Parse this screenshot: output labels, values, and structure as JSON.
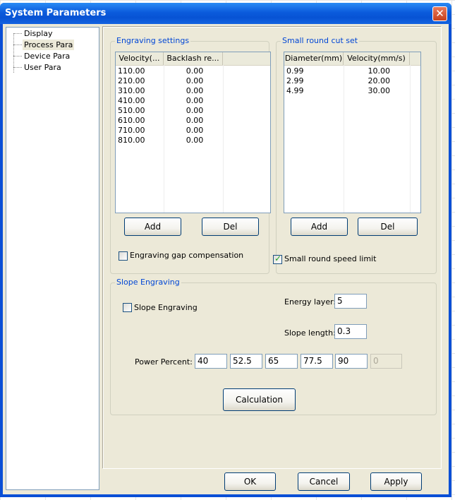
{
  "window": {
    "title": "System Parameters"
  },
  "tree": {
    "items": [
      "Display",
      "Process Para",
      "Device Para",
      "User Para"
    ],
    "selected": "Process Para"
  },
  "engraving_settings": {
    "title": "Engraving settings",
    "columns": [
      "Velocity(...",
      "Backlash re..."
    ],
    "rows": [
      [
        "110.00",
        "0.00"
      ],
      [
        "210.00",
        "0.00"
      ],
      [
        "310.00",
        "0.00"
      ],
      [
        "410.00",
        "0.00"
      ],
      [
        "510.00",
        "0.00"
      ],
      [
        "610.00",
        "0.00"
      ],
      [
        "710.00",
        "0.00"
      ],
      [
        "810.00",
        "0.00"
      ]
    ],
    "add_label": "Add",
    "del_label": "Del",
    "gap_compensation_label": "Engraving gap compensation",
    "gap_compensation_checked": false
  },
  "small_round": {
    "title": "Small round cut set",
    "columns": [
      "Diameter(mm)",
      "Velocity(mm/s)"
    ],
    "rows": [
      [
        "0.99",
        "10.00"
      ],
      [
        "2.99",
        "20.00"
      ],
      [
        "4.99",
        "30.00"
      ]
    ],
    "add_label": "Add",
    "del_label": "Del",
    "speed_limit_label": "Small round speed limit",
    "speed_limit_checked": true
  },
  "slope": {
    "title": "Slope Engraving",
    "checkbox_label": "Slope Engraving",
    "checkbox_checked": false,
    "energy_layer_label": "Energy layer:",
    "energy_layer_value": "5",
    "slope_length_label": "Slope length:",
    "slope_length_value": "0.3",
    "power_percent_label": "Power Percent:",
    "power_values": [
      "40",
      "52.5",
      "65",
      "77.5",
      "90",
      "0"
    ],
    "calculation_label": "Calculation"
  },
  "footer": {
    "ok_label": "OK",
    "cancel_label": "Cancel",
    "apply_label": "Apply"
  },
  "colors": {
    "titlebar": "#0b5bdc",
    "dialog_bg": "#ece9d8",
    "group_title": "#0046d5",
    "close_button": "#c7401d"
  }
}
